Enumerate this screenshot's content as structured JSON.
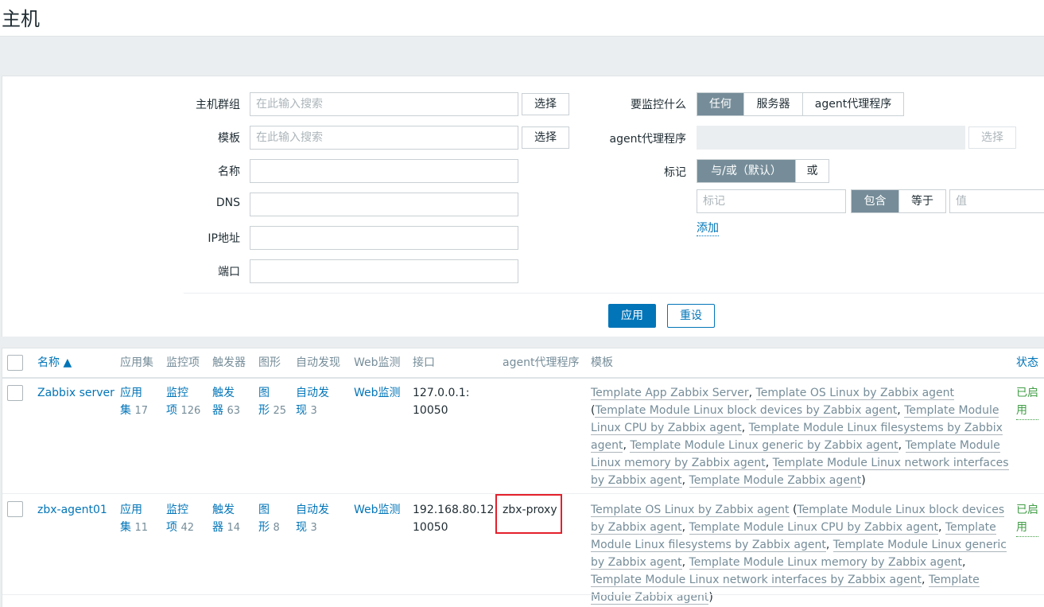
{
  "page": {
    "title": "主机"
  },
  "filter": {
    "host_groups_label": "主机群组",
    "host_groups_placeholder": "在此输入搜索",
    "templates_label": "模板",
    "templates_placeholder": "在此输入搜索",
    "select_label": "选择",
    "name_label": "名称",
    "dns_label": "DNS",
    "ip_label": "IP地址",
    "port_label": "端口",
    "monitored_by_label": "要监控什么",
    "monitored_by_options": [
      "任何",
      "服务器",
      "agent代理程序"
    ],
    "monitored_by_selected": "任何",
    "proxy_label": "agent代理程序",
    "tags_label": "标记",
    "tags_eval_options": [
      "与/或（默认）",
      "或"
    ],
    "tag_placeholder": "标记",
    "tag_op_options": [
      "包含",
      "等于"
    ],
    "value_placeholder": "值",
    "add_label": "添加",
    "apply_label": "应用",
    "reset_label": "重设"
  },
  "table": {
    "headers": {
      "name": "名称 ▲",
      "applications": "应用集",
      "items": "监控项",
      "triggers": "触发器",
      "graphs": "图形",
      "discovery": "自动发现",
      "web": "Web监测",
      "interface": "接口",
      "proxy": "agent代理程序",
      "templates": "模板",
      "status": "状态"
    },
    "rows": [
      {
        "name": "Zabbix server",
        "app_l1": "应用",
        "app_l2": "集",
        "app_count": "17",
        "items_l1": "监控",
        "items_l2": "项",
        "items_count": "126",
        "trig_l1": "触发",
        "trig_l2": "器",
        "trig_count": "63",
        "graph_l1": "图",
        "graph_l2": "形",
        "graph_count": "25",
        "disc_l1": "自动发",
        "disc_l2": "现",
        "disc_count": "3",
        "web": "Web监测",
        "iface_l1": "127.0.0.1:",
        "iface_l2": "10050",
        "proxy": "",
        "templates": {
          "t1": "Template App Zabbix Server",
          "sep1": ", ",
          "t2": "Template OS Linux by Zabbix agent",
          "open": " (",
          "t3": "Template Module Linux block devices by Zabbix agent",
          "sep3": ", ",
          "t4": "Template Module Linux CPU by Zabbix agent",
          "sep4": ", ",
          "t5": "Template Module Linux filesystems by Zabbix agent",
          "sep5": ", ",
          "t6": "Template Module Linux generic by Zabbix agent",
          "sep6": ", ",
          "t7": "Template Module Linux memory by Zabbix agent",
          "sep7": ", ",
          "t8": "Template Module Linux network interfaces by Zabbix agent",
          "sep8": ", ",
          "t9": "Template Module Zabbix agent",
          "close": ")"
        },
        "status_l1": "已启",
        "status_l2": "用"
      },
      {
        "name": "zbx-agent01",
        "app_l1": "应用",
        "app_l2": "集",
        "app_count": "11",
        "items_l1": "监控",
        "items_l2": "项",
        "items_count": "42",
        "trig_l1": "触发",
        "trig_l2": "器",
        "trig_count": "14",
        "graph_l1": "图",
        "graph_l2": "形",
        "graph_count": "8",
        "disc_l1": "自动发",
        "disc_l2": "现",
        "disc_count": "3",
        "web": "Web监测",
        "iface_l1": "192.168.80.12:",
        "iface_l2": "10050",
        "proxy": "zbx-proxy",
        "templates": {
          "t1": "Template OS Linux by Zabbix agent",
          "open": " (",
          "t2": "Template Module Linux block devices by Zabbix agent",
          "sep2": ", ",
          "t3": "Template Module Linux CPU by Zabbix agent",
          "sep3": ", ",
          "t4": "Template Module Linux filesystems by Zabbix agent",
          "sep4": ", ",
          "t5": "Template Module Linux generic by Zabbix agent",
          "sep5": ", ",
          "t6": "Template Module Linux memory by Zabbix agent",
          "sep6": ", ",
          "t7": "Template Module Linux network interfaces by Zabbix agent",
          "sep7": ", ",
          "t8": "Template Module Zabbix agent",
          "close": ")"
        },
        "status_l1": "已启",
        "status_l2": "用"
      }
    ]
  },
  "colors": {
    "link": "#0275b8",
    "enabled": "#429e47",
    "active_segment": "#768d99",
    "highlight_box": "#e4202c"
  }
}
